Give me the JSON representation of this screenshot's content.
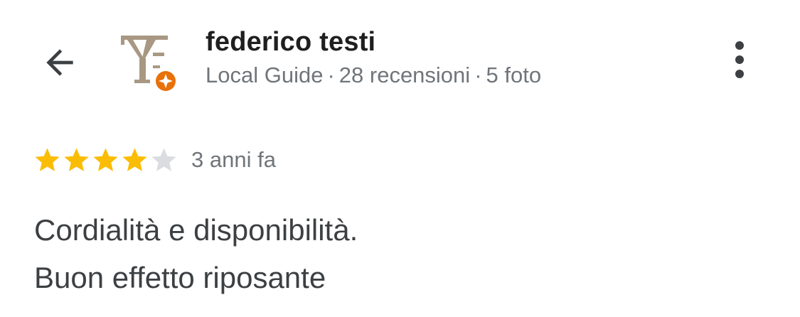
{
  "header": {
    "back_icon": "arrow-left-icon",
    "avatar_icon": "monogram-avatar",
    "badge_icon": "local-guide-badge-icon",
    "more_icon": "more-vert-icon"
  },
  "reviewer": {
    "name": "federico testi",
    "level": "Local Guide",
    "separator": "·",
    "reviews": "28 recensioni",
    "photos": "5 foto"
  },
  "review": {
    "rating": 4,
    "max_rating": 5,
    "time": "3 anni fa",
    "lines": [
      "Cordialità e disponibilità.",
      "Buon effetto riposante"
    ]
  },
  "colors": {
    "star_filled": "#fbbc04",
    "star_empty": "#dadce0",
    "badge": "#e8710a",
    "monogram": "#a89883",
    "name_text": "#1f1f1f",
    "secondary_text": "#70757a",
    "body_text": "#3c4043"
  }
}
